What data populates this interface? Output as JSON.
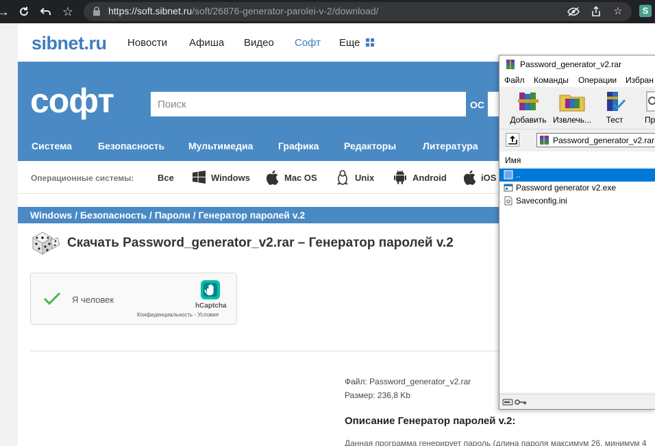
{
  "browser": {
    "url_domain": "https://soft.sibnet.ru",
    "url_path": "/soft/26876-generator-parolei-v-2/download/",
    "extension_letter": "S"
  },
  "site": {
    "logo": "sibnet.ru",
    "nav": [
      "Новости",
      "Афиша",
      "Видео",
      "Софт",
      "Еще"
    ],
    "active_nav": "Софт",
    "section_title": "софт",
    "search_placeholder": "Поиск",
    "os_label": "ОС",
    "categories": [
      "Система",
      "Безопасность",
      "Мультимедиа",
      "Графика",
      "Редакторы",
      "Литература"
    ],
    "os_bar_label": "Операционные системы:",
    "os_list": [
      "Все",
      "Windows",
      "Mac OS",
      "Unix",
      "Android",
      "iOS"
    ]
  },
  "breadcrumb": "Windows / Безопасность / Пароли / Генератор паролей v.2",
  "page_title": "Скачать Password_generator_v2.rar – Генератор паролей v.2",
  "captcha": {
    "label": "Я человек",
    "brand": "hCaptcha",
    "links": "Конфиденциальность - Условия"
  },
  "file": {
    "name_line": "Файл: Password_generator_v2.rar",
    "size_line": "Размер: 236,8 Kb"
  },
  "description": {
    "heading": "Описание Генератор паролей v.2:",
    "text": "Данная программа генерирует пароль (длина пароля максимум 26, минимум 4"
  },
  "winrar": {
    "title": "Password_generator_v2.rar",
    "menu": [
      "Файл",
      "Команды",
      "Операции",
      "Избран"
    ],
    "toolbar": [
      "Добавить",
      "Извлечь...",
      "Тест",
      "Прос"
    ],
    "path": "Password_generator_v2.rar -",
    "column_name": "Имя",
    "files": [
      "..",
      "Password generator v2.exe",
      "Saveconfig.ini"
    ],
    "selected_index": 0
  },
  "colors": {
    "brand_blue": "#4a8ac4",
    "logo_blue": "#3d7fbd",
    "chrome_dark": "#202124",
    "selection_blue": "#0078d7"
  }
}
